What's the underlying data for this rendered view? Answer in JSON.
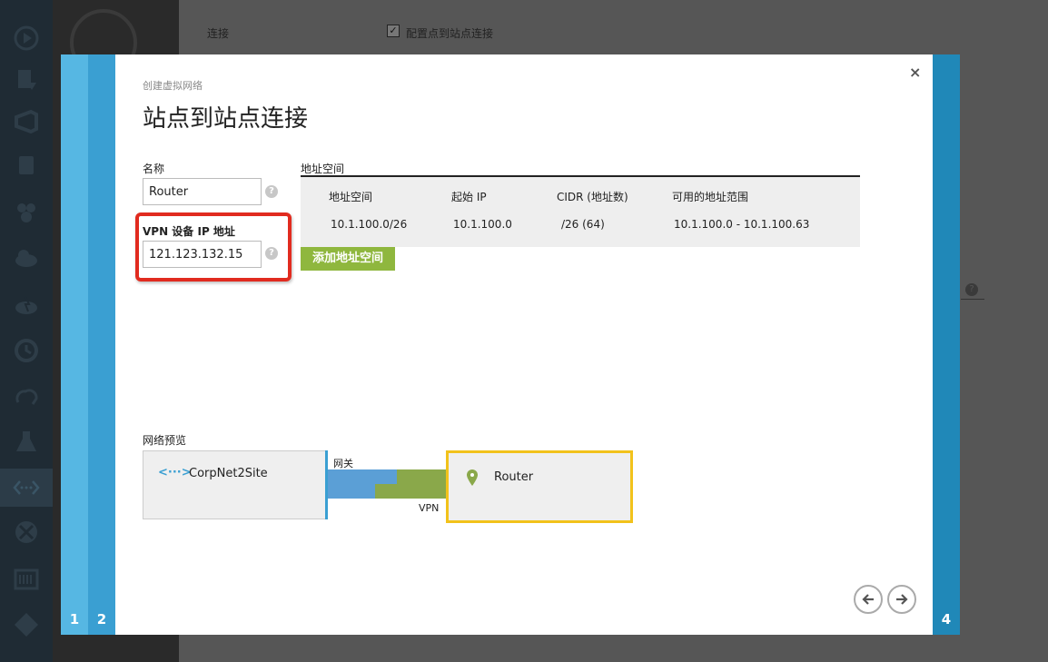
{
  "background": {
    "nav_icons": [
      "media-services-icon",
      "deploy-icon",
      "visual-studio-icon",
      "storage-icon",
      "hdinsight-icon",
      "cloud-services-icon",
      "mobile-services-icon",
      "scheduler-icon",
      "cloud-sync-icon",
      "machine-learning-icon",
      "networks-icon",
      "traffic-manager-icon",
      "batch-icon",
      "git-icon"
    ],
    "label": "连接",
    "checkbox_label": "配置点到站点连接",
    "help": "?"
  },
  "wizard": {
    "steps": [
      "1",
      "2",
      "4"
    ],
    "breadcrumb": "创建虚拟网络",
    "title": "站点到站点连接",
    "close_label": "×"
  },
  "form": {
    "name_label": "名称",
    "name_value": "Router",
    "vpn_label": "VPN 设备 IP 地址",
    "vpn_value": "121.123.132.15",
    "help": "?"
  },
  "address_space": {
    "title": "地址空间",
    "headers": [
      "地址空间",
      "起始 IP",
      "CIDR (地址数)",
      "可用的地址范围"
    ],
    "row": [
      "10.1.100.0/26",
      "10.1.100.0",
      "/26 (64)",
      "10.1.100.0 - 10.1.100.63"
    ],
    "add_button": "添加地址空间"
  },
  "preview": {
    "label": "网络预览",
    "local_network_icon": "<···>",
    "local_network": "CorpNet2Site",
    "gateway_label": "网关",
    "vpn_label": "VPN",
    "remote_network": "Router"
  },
  "colors": {
    "accent_green": "#8fb73e",
    "highlight_red": "#e12b1f",
    "remote_border": "#f2c21b",
    "link_blue": "#3a9fd2"
  }
}
